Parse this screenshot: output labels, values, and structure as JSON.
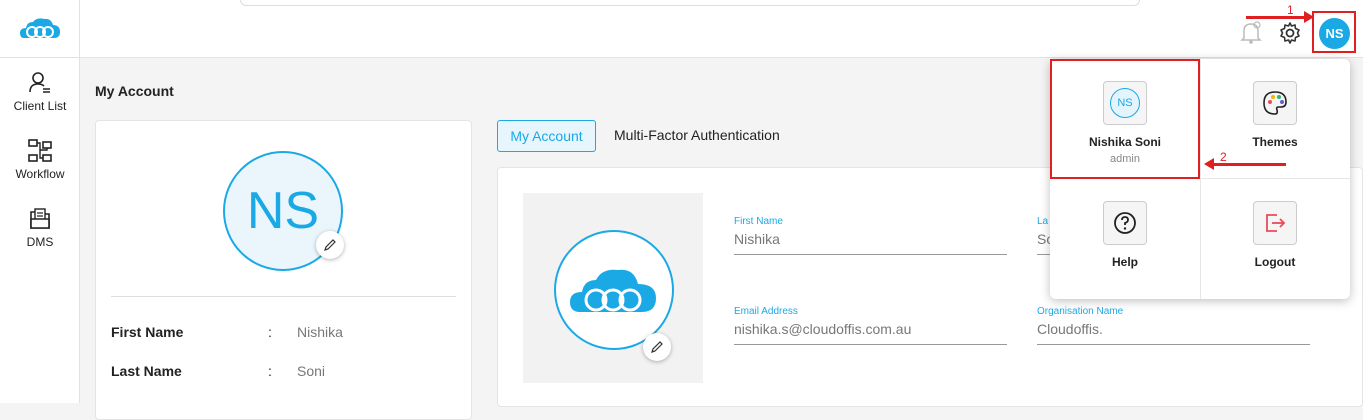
{
  "header": {
    "avatar_initials": "NS",
    "annotation_step_1": "1",
    "accent_color": "#1ba9e6",
    "annotation_color": "#e02020"
  },
  "sidebar": {
    "items": [
      {
        "label": "Client List",
        "icon": "client-list-icon"
      },
      {
        "label": "Workflow",
        "icon": "workflow-icon"
      },
      {
        "label": "DMS",
        "icon": "dms-icon"
      }
    ]
  },
  "page": {
    "title": "My Account"
  },
  "profile": {
    "initials": "NS",
    "rows": [
      {
        "key": "First Name",
        "sep": ":",
        "value": "Nishika"
      },
      {
        "key": "Last Name",
        "sep": ":",
        "value": "Soni"
      }
    ]
  },
  "tabs": [
    {
      "label": "My Account",
      "active": true
    },
    {
      "label": "Multi-Factor Authentication",
      "active": false
    }
  ],
  "form": {
    "first_name": {
      "label": "First Name",
      "value": "Nishika"
    },
    "last_name": {
      "label": "La",
      "value": "So"
    },
    "email": {
      "label": "Email Address",
      "value": "nishika.s@cloudoffis.com.au"
    },
    "organisation": {
      "label": "Organisation Name",
      "value": "Cloudoffis."
    }
  },
  "dropdown": {
    "user": {
      "initials": "NS",
      "name": "Nishika Soni",
      "role": "admin"
    },
    "themes_label": "Themes",
    "help_label": "Help",
    "logout_label": "Logout",
    "annotation_step_2": "2"
  }
}
